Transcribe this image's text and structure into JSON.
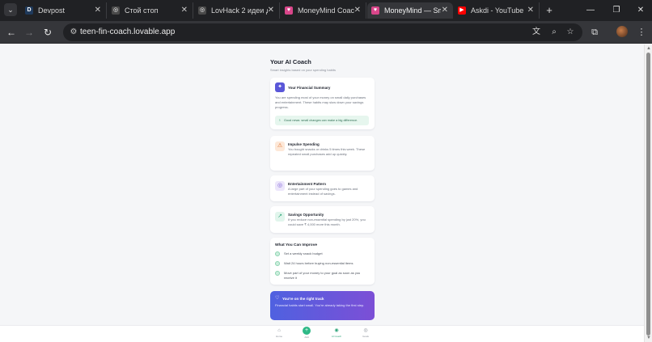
{
  "browser": {
    "tabs": [
      {
        "title": "Devpost",
        "favicon": "D",
        "favicon_color": "#1f3a5c",
        "active": false
      },
      {
        "title": "Стой стоп",
        "favicon": "◎",
        "favicon_color": "#444444",
        "active": false
      },
      {
        "title": "LovHack 2 идеи д",
        "favicon": "◎",
        "favicon_color": "#444444",
        "active": false
      },
      {
        "title": "MoneyMind Coac",
        "favicon": "♥",
        "favicon_color": "#d9468a",
        "active": false
      },
      {
        "title": "MoneyMind — Sm",
        "favicon": "♥",
        "favicon_color": "#d9468a",
        "active": true
      },
      {
        "title": "Askdi - YouTube",
        "favicon": "▶",
        "favicon_color": "#ff0000",
        "active": false
      }
    ],
    "url": "teen-fin-coach.lovable.app"
  },
  "page": {
    "title": "Your AI Coach",
    "subtitle": "Smart insights based on your spending habits",
    "summary": {
      "title": "Your Financial Summary",
      "text": "You are spending most of your money on small daily purchases and entertainment. These habits may slow down your savings progress.",
      "good_news": "Good news: small changes can make a big difference."
    },
    "insights": [
      {
        "title": "Impulse Spending",
        "text": "You bought snacks or drinks 5 times this week. These repeated small purchases add up quickly.",
        "icon": "warning-icon",
        "icon_color": "#e0702c",
        "icon_bg": "#fde8d8"
      },
      {
        "title": "Entertainment Pattern",
        "text": "A large part of your spending goes to games and entertainment instead of savings.",
        "icon": "gamepad-icon",
        "icon_color": "#7b5cd6",
        "icon_bg": "#ece6fb"
      },
      {
        "title": "Savings Opportunity",
        "text": "If you reduce non-essential spending by just 20%, you could save ₹ 4,000 more this month.",
        "icon": "trend-up-icon",
        "icon_color": "#2fa57a",
        "icon_bg": "#e1f5ec"
      }
    ],
    "improve": {
      "title": "What You Can Improve",
      "items": [
        "Set a weekly snack budget",
        "Wait 24 hours before buying non-essential items",
        "Move part of your money to your goal as soon as you receive it"
      ]
    },
    "on_track": {
      "title": "You're on the right track",
      "text": "Financial habits start small. You're already taking the first step."
    }
  },
  "nav": {
    "home": "Home",
    "add": "Add",
    "coach": "AI Coach",
    "goals": "Goals"
  },
  "colors": {
    "accent": "#2fb987",
    "card_gradient_start": "#4f61e0",
    "card_gradient_end": "#7c4fd6"
  }
}
